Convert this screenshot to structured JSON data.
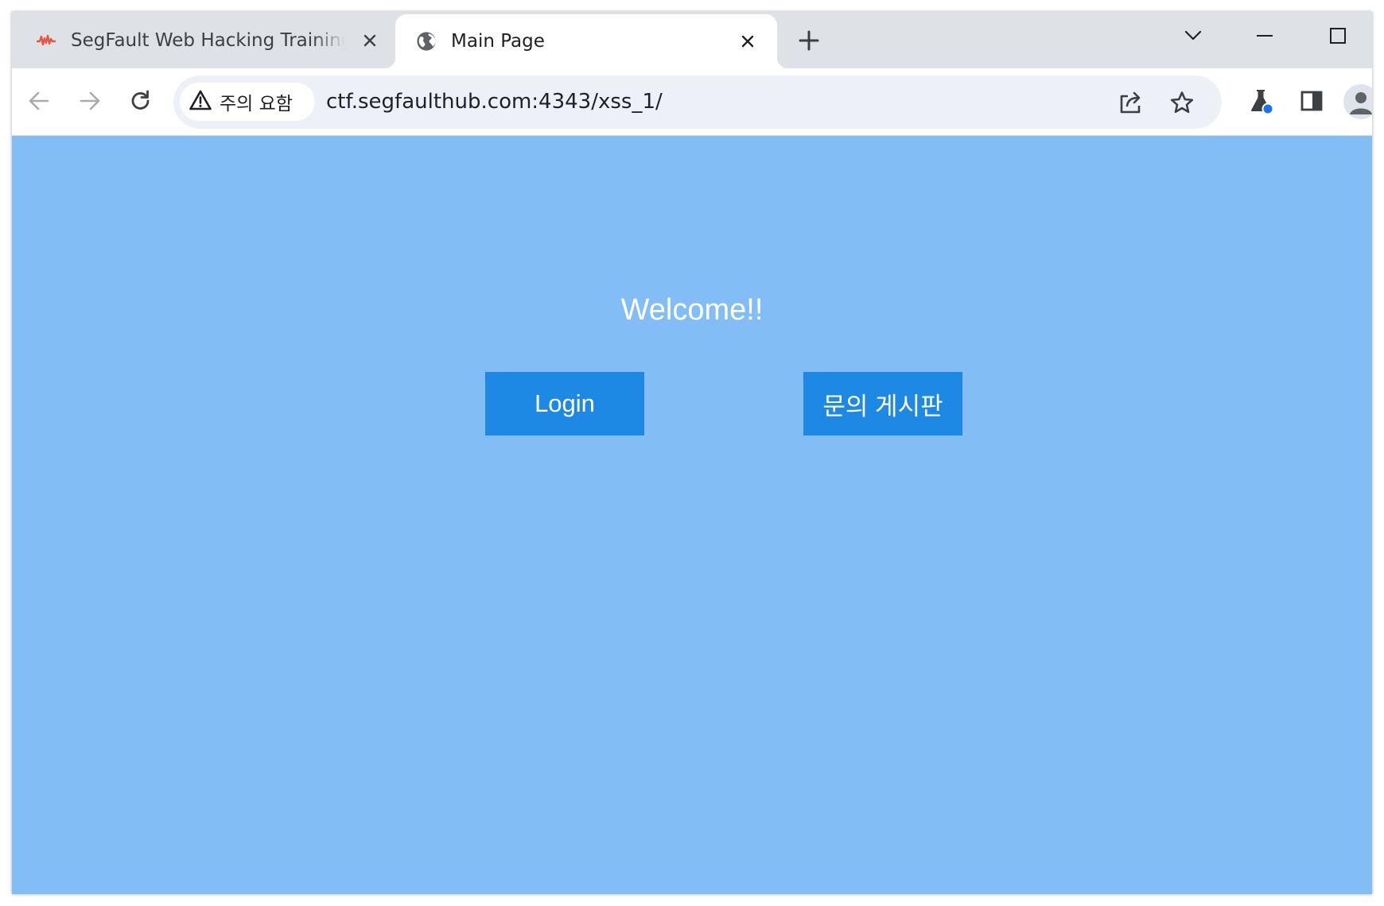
{
  "browser": {
    "tabs": [
      {
        "title": "SegFault Web Hacking Training",
        "favicon": "segfault-logo-icon",
        "active": false
      },
      {
        "title": "Main Page",
        "favicon": "globe-icon",
        "active": true
      }
    ],
    "security_chip": {
      "icon": "warning-triangle-icon",
      "label": "주의 요함"
    },
    "url": "ctf.segfaulthub.com:4343/xss_1/",
    "accent_color": "#1a73e8"
  },
  "page": {
    "background_color": "#83bdf5",
    "welcome_text": "Welcome!!",
    "buttons": [
      {
        "label": "Login",
        "color": "#1e88e5"
      },
      {
        "label": "문의 게시판",
        "color": "#1e88e5"
      }
    ]
  }
}
